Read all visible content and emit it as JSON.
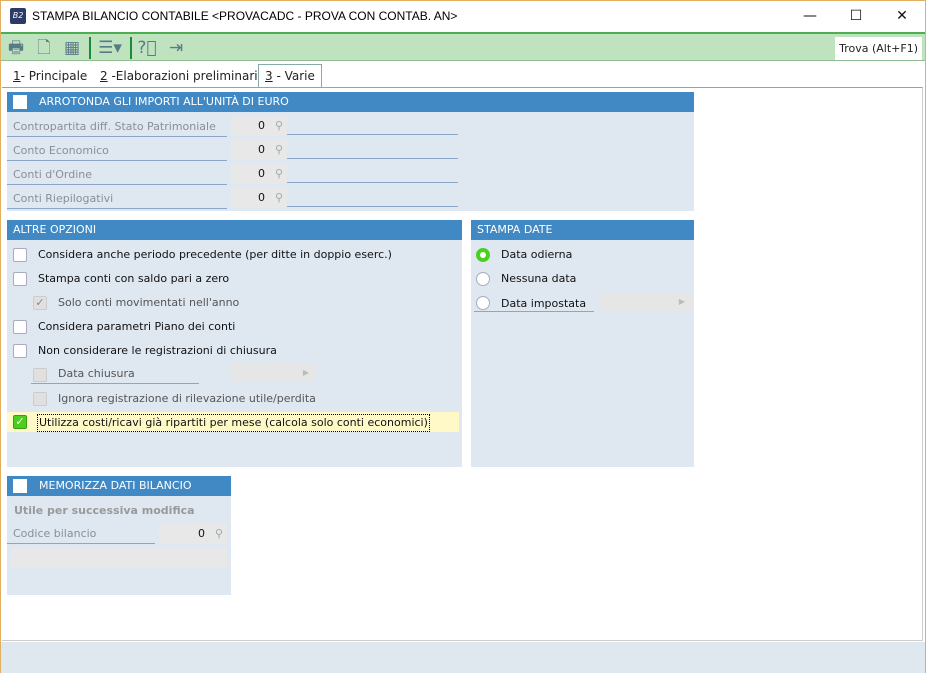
{
  "window": {
    "title": "STAMPA BILANCIO CONTABILE <PROVACADC - PROVA CON CONTAB. AN>",
    "app_icon": "B2",
    "minimize": "—",
    "maximize": "☐",
    "close": "✕"
  },
  "toolbar": {
    "search_label": "Trova (Alt+F1)",
    "icons": [
      "printer-icon",
      "print-preview-icon",
      "calendar-icon",
      "menu-icon",
      "help-icon",
      "exit-icon"
    ]
  },
  "tabs": [
    {
      "num": "1",
      "label": "- Principale"
    },
    {
      "num": "2",
      "label": " -Elaborazioni preliminari"
    },
    {
      "num": "3",
      "label": " - Varie"
    }
  ],
  "arrotonda": {
    "title": "ARROTONDA GLI IMPORTI ALL'UNITÀ DI EURO",
    "checked": false,
    "fields": [
      {
        "label": "Contropartita diff. Stato Patrimoniale",
        "value": "0"
      },
      {
        "label": "Conto Economico",
        "value": "0"
      },
      {
        "label": "Conti d'Ordine",
        "value": "0"
      },
      {
        "label": "Conti Riepilogativi",
        "value": "0"
      }
    ]
  },
  "altre": {
    "title": "ALTRE OPZIONI",
    "options": [
      {
        "label": "Considera anche periodo precedente (per ditte in doppio eserc.)",
        "checked": false
      },
      {
        "label": "Stampa conti con saldo pari a zero",
        "checked": false
      },
      {
        "label": "Solo conti movimentati nell'anno",
        "checked": true,
        "disabled": true
      },
      {
        "label": "Considera parametri Piano dei conti",
        "checked": false
      },
      {
        "label": "Non considerare le registrazioni di chiusura",
        "checked": false
      },
      {
        "label": "Data chiusura",
        "checked": false,
        "disabled": true
      },
      {
        "label": "Ignora registrazione di rilevazione utile/perdita",
        "checked": false,
        "disabled": true
      },
      {
        "label": "Utilizza costi/ricavi già ripartiti per mese  (calcola solo conti economici)",
        "checked": true
      }
    ]
  },
  "stampa_date": {
    "title": "STAMPA DATE",
    "options": [
      {
        "label": "Data odierna",
        "selected": true
      },
      {
        "label": "Nessuna data",
        "selected": false
      },
      {
        "label": "Data impostata",
        "selected": false
      }
    ]
  },
  "memorizza": {
    "title": "MEMORIZZA DATI BILANCIO",
    "checked": false,
    "subtitle": "Utile per successiva modifica",
    "field_label": "Codice bilancio",
    "field_value": "0"
  }
}
